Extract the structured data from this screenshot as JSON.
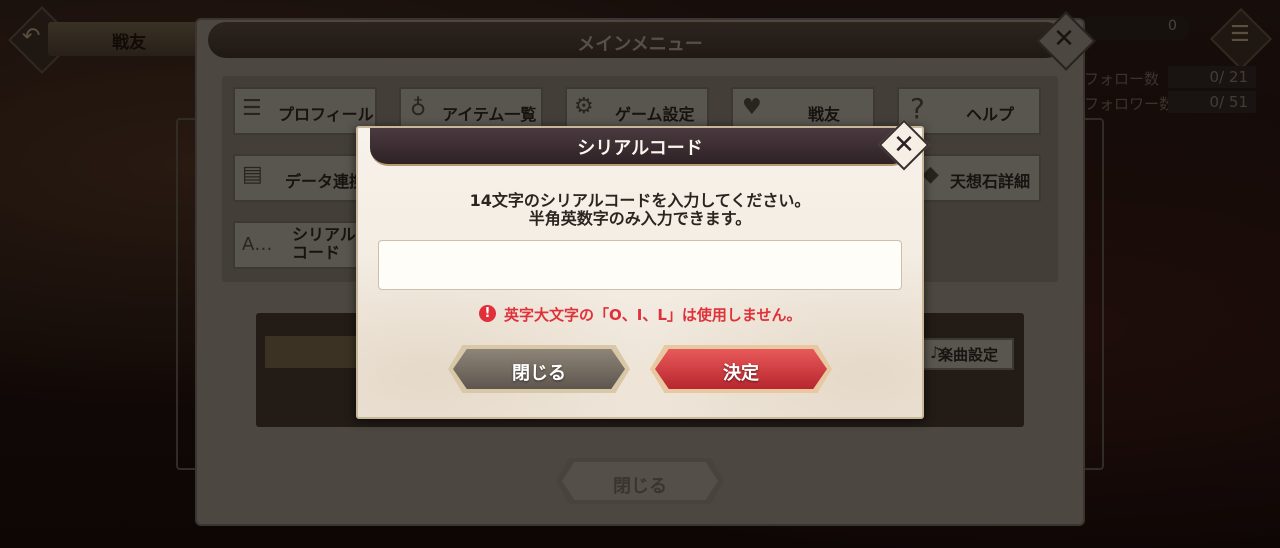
{
  "background": {
    "top_title": "戦友",
    "currency_value": "0",
    "stats": [
      {
        "label": "フォロー数",
        "value": "0/  21"
      },
      {
        "label": "フォロワー数",
        "value": "0/  51"
      }
    ]
  },
  "main_menu": {
    "title": "メインメニュー",
    "tiles": [
      {
        "label": "プロフィール",
        "icon": "profile-icon"
      },
      {
        "label": "アイテム一覧",
        "icon": "bag-icon"
      },
      {
        "label": "ゲーム設定",
        "icon": "gear-icon"
      },
      {
        "label": "戦友",
        "icon": "friends-icon"
      },
      {
        "label": "ヘルプ",
        "icon": "question-icon"
      },
      {
        "label": "データ連携",
        "icon": "data-link-icon"
      },
      {
        "label": "天想石詳細",
        "icon": "gem-icon"
      },
      {
        "label": "シリアル\nコード",
        "icon": "serial-icon"
      }
    ],
    "music_settings_label": "楽曲設定",
    "close_label": "閉じる"
  },
  "dialog": {
    "title": "シリアルコード",
    "instruction_line1": "14文字のシリアルコードを入力してください。",
    "instruction_line2": "半角英数字のみ入力できます。",
    "input_value": "",
    "input_placeholder": "",
    "warning": "英字大文字の「O、I、L」は使用しません。",
    "cancel_label": "閉じる",
    "confirm_label": "決定"
  },
  "colors": {
    "confirm": "#d8333a",
    "warning": "#e0303a",
    "header": "#3a2c30"
  }
}
